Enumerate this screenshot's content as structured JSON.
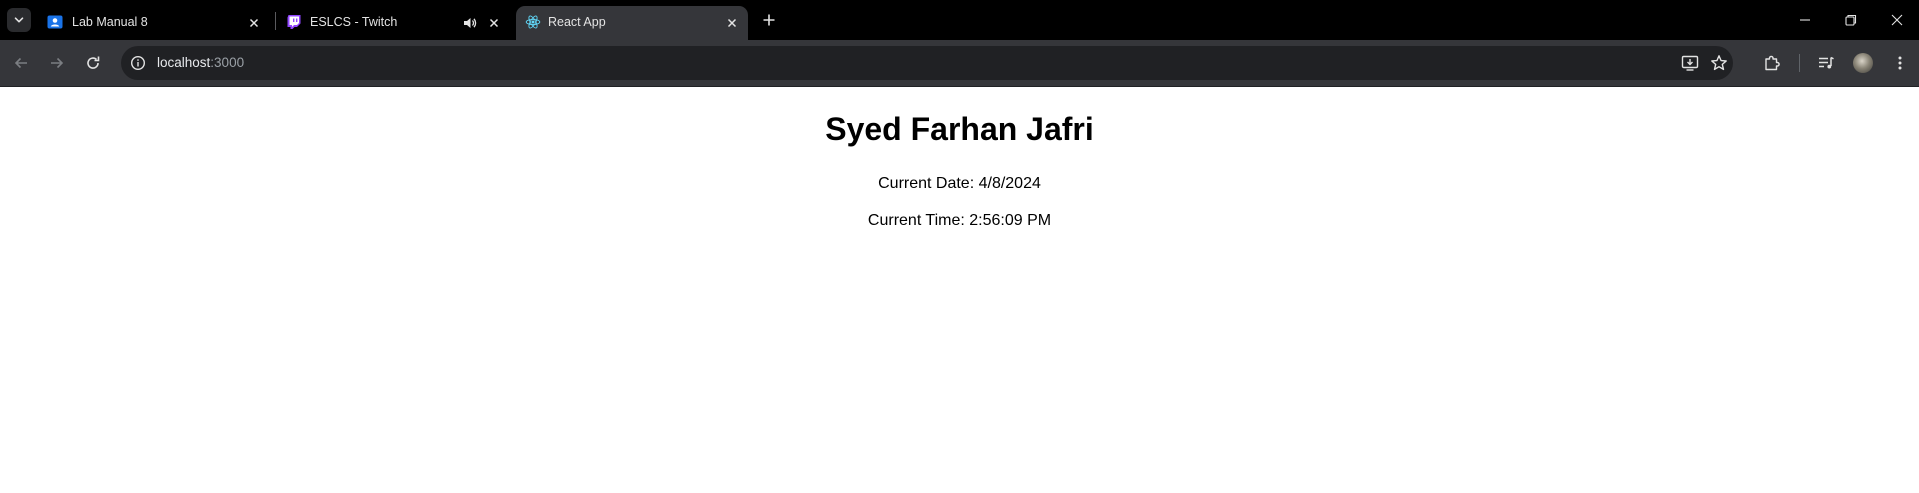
{
  "browser": {
    "tabs": [
      {
        "title": "Lab Manual 8",
        "icon": "google-classroom-icon",
        "active": false
      },
      {
        "title": "ESLCS - Twitch",
        "icon": "twitch-icon",
        "active": false,
        "audio": true
      },
      {
        "title": "React App",
        "icon": "react-icon",
        "active": true
      }
    ],
    "address_bar": {
      "host": "localhost",
      "port": ":3000"
    }
  },
  "page": {
    "heading": "Syed Farhan Jafri",
    "date_text": "Current Date: 4/8/2024",
    "time_text": "Current Time: 2:56:09 PM"
  },
  "colors": {
    "titlebar_bg": "#000000",
    "toolbar_bg": "#35363a",
    "omnibox_bg": "#202124",
    "page_bg": "#ffffff"
  }
}
